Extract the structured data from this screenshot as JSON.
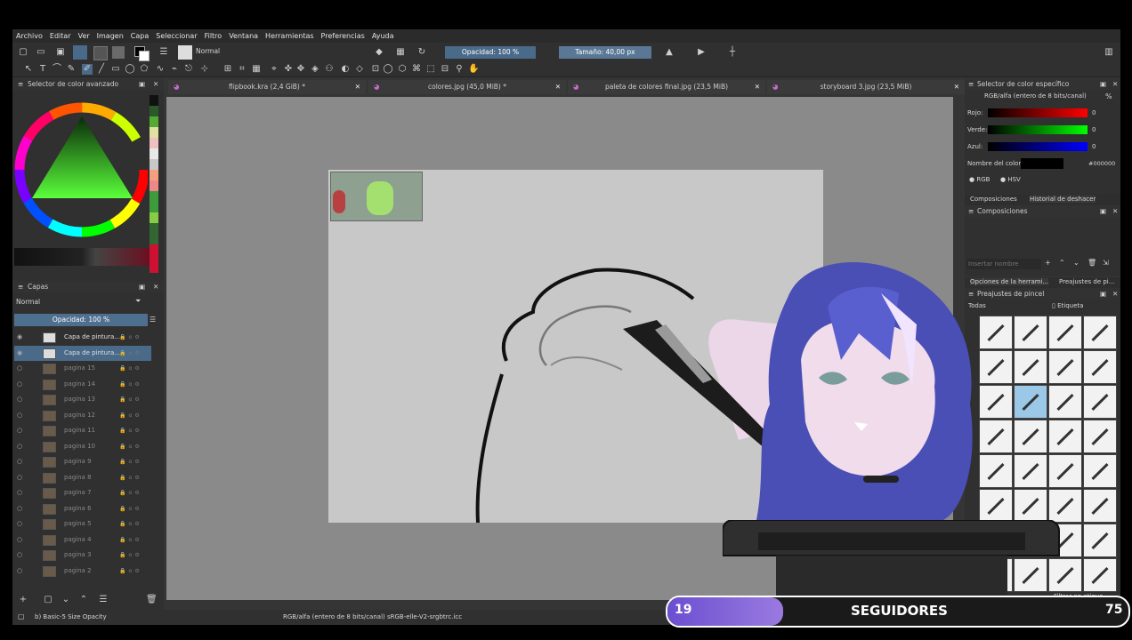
{
  "menu": [
    "Archivo",
    "Editar",
    "Ver",
    "Imagen",
    "Capa",
    "Seleccionar",
    "Filtro",
    "Ventana",
    "Herramientas",
    "Preferencias",
    "Ayuda"
  ],
  "toolbar": {
    "blend_mode": "Normal",
    "opacity_label": "Opacidad: 100 %",
    "size_label": "Tamaño: 40,00 px"
  },
  "color_selector": {
    "title": "Selector de color avanzado"
  },
  "tabs": [
    {
      "label": "flipbook.kra (2,4 GiB) *"
    },
    {
      "label": "colores.jpg (45,0 MiB) *"
    },
    {
      "label": "paleta de colores final.jpg (23,5 MiB)"
    },
    {
      "label": "storyboard 3.jpg (23,5 MiB)"
    }
  ],
  "layers": {
    "title": "Capas",
    "blend": "Normal",
    "opacity": "Opacidad:  100 %",
    "rows": [
      {
        "name": "Capa de pintura..."
      },
      {
        "name": "Capa de pintura..."
      },
      {
        "name": "pagina 15"
      },
      {
        "name": "pagina 14"
      },
      {
        "name": "pagina 13"
      },
      {
        "name": "pagina 12"
      },
      {
        "name": "pagina 11"
      },
      {
        "name": "pagina 10"
      },
      {
        "name": "pagina 9"
      },
      {
        "name": "pagina 8"
      },
      {
        "name": "pagina 7"
      },
      {
        "name": "pagina 6"
      },
      {
        "name": "pagina 5"
      },
      {
        "name": "pagina 4"
      },
      {
        "name": "pagina 3"
      },
      {
        "name": "pagina 2"
      }
    ]
  },
  "specific_color": {
    "title": "Selector de color específico",
    "model": "RGB/alfa (entero de 8 bits/canal)",
    "rojo_label": "Rojo:",
    "rojo_value": "0",
    "verde_label": "Verde:",
    "verde_value": "0",
    "azul_label": "Azul:",
    "azul_value": "0",
    "name_label": "Nombre del color:",
    "hex": "#000000",
    "rgb_label": "RGB",
    "hsv_label": "HSV"
  },
  "compositions": {
    "tab1": "Composiciones",
    "tab2": "Historial de deshacer",
    "title": "Composiciones",
    "name_placeholder": "Insertar nombre"
  },
  "tool_options": {
    "tab1": "Opciones de la herrami...",
    "tab2": "Preajustes de pi..."
  },
  "brush_presets": {
    "title": "Preajustes de pincel",
    "filter": "Todas",
    "tag": "Etiqueta",
    "search": "Filtrar en etique"
  },
  "status": {
    "brush": "b) Basic-5 Size Opacity",
    "color_info": "RGB/alfa (entero de 8 bits/canal)  sRGB-elle-V2-srgbtrc.icc"
  },
  "overlay": {
    "count": "19",
    "label": "SEGUIDORES",
    "goal": "75",
    "progress": 0.25
  },
  "colors": {
    "app_bg": "#353535",
    "canvas_bg": "#8a8a8a",
    "paper": "#c8c8c8",
    "accent": "#4a6a8a",
    "overlay_fill": "#7b5fd0"
  }
}
